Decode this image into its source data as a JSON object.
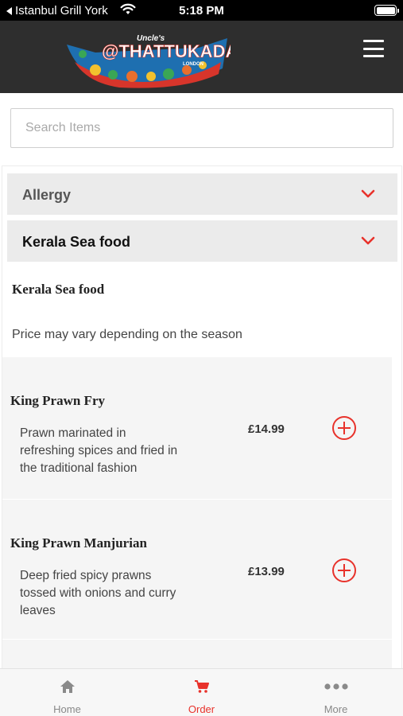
{
  "status_bar": {
    "back_label": "Istanbul Grill York",
    "time": "5:18 PM"
  },
  "header": {
    "logo": {
      "top_text": "Uncle's",
      "main_text": "@THATTUKADA",
      "sub_text": "LONDON"
    },
    "menu_icon": "hamburger-menu-icon"
  },
  "search": {
    "placeholder": "Search Items",
    "value": ""
  },
  "categories": [
    {
      "label": "Allergy",
      "expanded": false
    },
    {
      "label": "Kerala Sea food",
      "expanded": true
    }
  ],
  "section": {
    "title": "Kerala Sea food",
    "note": "Price may vary depending on the season"
  },
  "items": [
    {
      "name": "King Prawn Fry",
      "description": "Prawn marinated in refreshing spices and fried in the traditional fashion",
      "price": "£14.99"
    },
    {
      "name": "King Prawn Manjurian",
      "description": "Deep fried spicy prawns tossed with onions and curry leaves",
      "price": "£13.99"
    }
  ],
  "bottom_nav": [
    {
      "label": "Home",
      "icon": "home-icon",
      "active": false
    },
    {
      "label": "Order",
      "icon": "cart-icon",
      "active": true
    },
    {
      "label": "More",
      "icon": "more-dots-icon",
      "active": false
    }
  ],
  "colors": {
    "accent": "#e8322b",
    "header_bg": "#2e2e2e",
    "category_bg": "#ebebeb",
    "item_bg": "#f5f5f5"
  }
}
